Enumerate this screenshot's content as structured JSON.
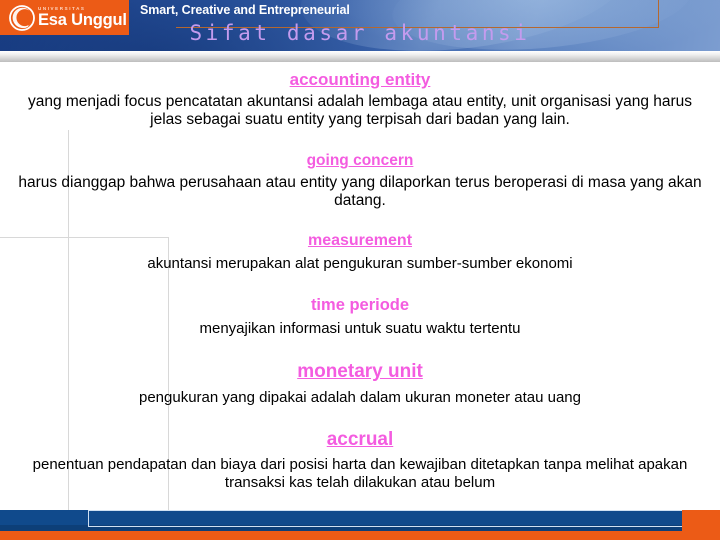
{
  "header": {
    "logo": {
      "university_small": "UNIVERSITAS",
      "name": "Esa Unggul",
      "icon": "esa-unggul-swirl-logo",
      "background_color": "#ec5b16"
    },
    "tagline": "Smart, Creative and Entrepreneurial",
    "title": "Sifat dasar akuntansi",
    "title_color": "#c49bee",
    "background_color": "#27509a"
  },
  "content": {
    "term_color": "#f45ce0",
    "body_color": "#000000",
    "blocks": [
      {
        "term": "accounting entity",
        "underlined": true,
        "description": "yang menjadi focus pencatatan akuntansi adalah lembaga atau entity, unit organisasi yang harus jelas sebagai suatu entity yang terpisah dari badan yang lain."
      },
      {
        "term": "going concern",
        "underlined": true,
        "description": "harus dianggap bahwa perusahaan atau entity yang dilaporkan terus beroperasi di masa yang akan datang."
      },
      {
        "term": "measurement",
        "underlined": true,
        "description": "akuntansi merupakan alat pengukuran sumber-sumber ekonomi"
      },
      {
        "term": "time periode",
        "underlined": false,
        "description": "menyajikan informasi untuk suatu waktu tertentu"
      },
      {
        "term": "monetary unit",
        "underlined": true,
        "description": "pengukuran yang dipakai adalah dalam ukuran moneter atau uang"
      },
      {
        "term": "accrual",
        "underlined": true,
        "description": "penentuan pendapatan dan biaya dari posisi harta dan kewajiban ditetapkan tanpa melihat apakan transaksi kas telah dilakukan atau belum"
      }
    ]
  },
  "footer": {
    "bar_color": "#104a8c",
    "accent_color": "#ec5b16"
  }
}
